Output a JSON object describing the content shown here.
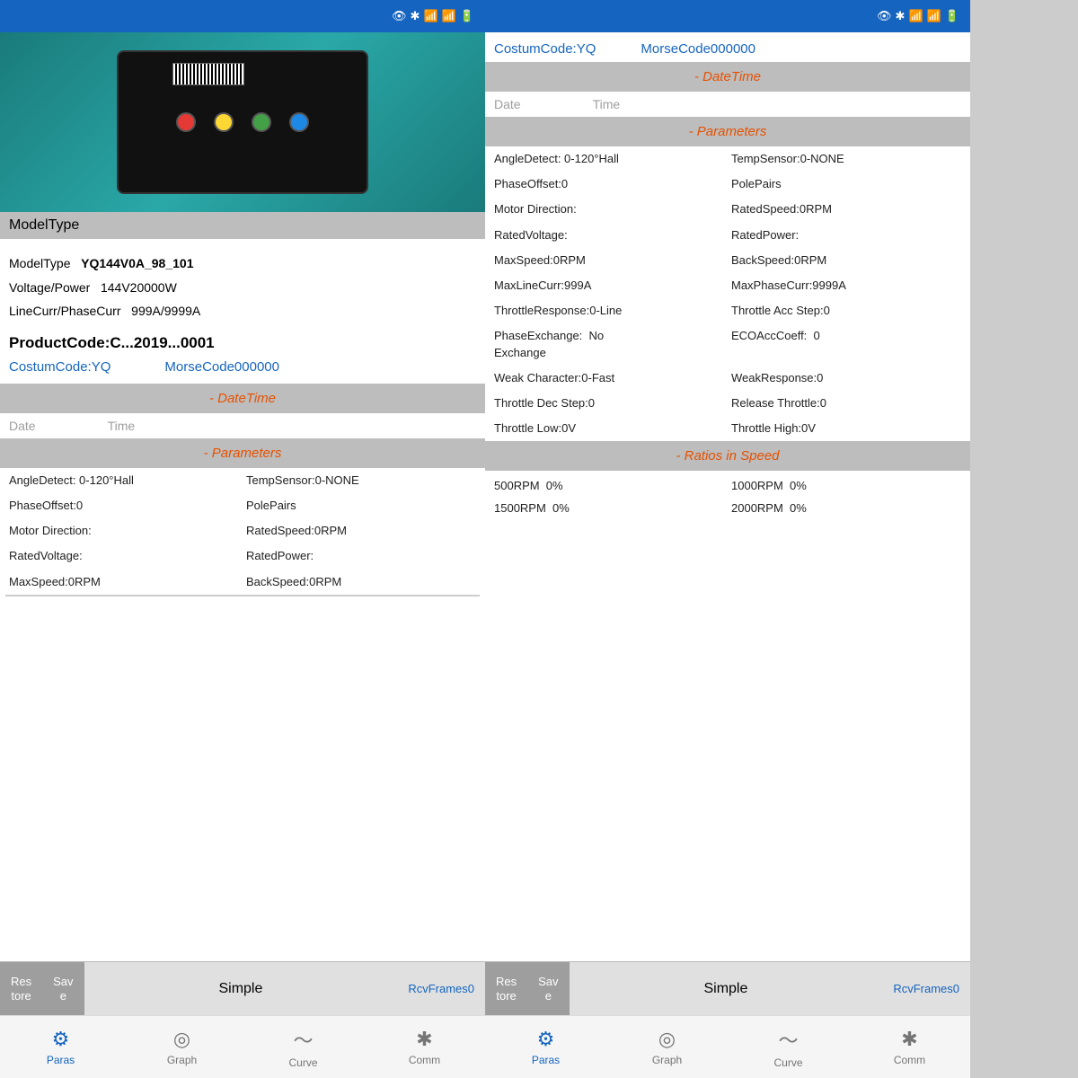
{
  "panel_left": {
    "status_bar": {
      "icons": "👁 ✱ 📶 📶 🔋"
    },
    "model_type_header": "ModelType",
    "model_info": {
      "model_type_label": "ModelType",
      "model_type_value": "YQ144V0A_98_101",
      "voltage_label": "Voltage/Power",
      "voltage_value": "144V20000W",
      "line_curr_label": "LineCurr/PhaseCurr",
      "line_curr_value": "999A/9999A"
    },
    "product_code": "ProductCode:C...2019...0001",
    "costum_code": "CostumCode:YQ",
    "morse_code": "MorseCode000000",
    "datetime_header": "- DateTime",
    "date_label": "Date",
    "time_label": "Time",
    "parameters_header": "- Parameters",
    "params": [
      {
        "left": "AngleDetect: 0-120°Hall",
        "right": "TempSensor:0-NONE"
      },
      {
        "left": "PhaseOffset:0",
        "right": "PolePairs"
      },
      {
        "left": "Motor Direction:",
        "right": "RatedSpeed:0RPM"
      },
      {
        "left": "RatedVoltage:",
        "right": "RatedPower:"
      },
      {
        "left": "MaxSpeed:0RPM (partial)",
        "right": "BackSpeed:0RPM (partial)"
      }
    ],
    "toolbar": {
      "restore": "Res\ntore",
      "save": "Sav\ne",
      "simple": "Simple",
      "rcv_frames": "RcvFrames0"
    },
    "nav": {
      "paras": "Paras",
      "graph": "Graph",
      "curve": "Curve",
      "comm": "Comm"
    }
  },
  "panel_right": {
    "status_bar": {
      "icons": "👁 ✱ 📶 📶 🔋"
    },
    "costum_code": "CostumCode:YQ",
    "morse_code": "MorseCode000000",
    "datetime_header": "- DateTime",
    "date_label": "Date",
    "time_label": "Time",
    "parameters_header": "- Parameters",
    "params": [
      {
        "left": "AngleDetect: 0-120°Hall",
        "right": "TempSensor:0-NONE"
      },
      {
        "left": "PhaseOffset:0",
        "right": "PolePairs"
      },
      {
        "left": "Motor Direction:",
        "right": "RatedSpeed:0RPM"
      },
      {
        "left": "RatedVoltage:",
        "right": "RatedPower:"
      },
      {
        "left": "MaxSpeed:0RPM",
        "right": "BackSpeed:0RPM"
      },
      {
        "left": "MaxLineCurr:999A",
        "right": "MaxPhaseCurr:9999A"
      },
      {
        "left": "ThrottleResponse:0-Line",
        "right": "Throttle Acc Step:0"
      },
      {
        "left": "PhaseExchange:  No\nExchange",
        "right": "ECOAccCoeff:  0"
      },
      {
        "left": "Weak Character:0-Fast",
        "right": "WeakResponse:0"
      },
      {
        "left": "Throttle Dec Step:0",
        "right": "Release Throttle:0"
      },
      {
        "left": "Throttle Low:0V",
        "right": "Throttle High:0V"
      }
    ],
    "ratios_header": "- Ratios in Speed",
    "ratios": [
      {
        "left": "500RPM  0%",
        "right": "1000RPM  0%"
      },
      {
        "left": "1500RPM  0%",
        "right": "2000RPM  0%"
      }
    ],
    "toolbar": {
      "restore": "Res\ntore",
      "save": "Sav\ne",
      "simple": "Simple",
      "rcv_frames": "RcvFrames0"
    },
    "nav": {
      "paras": "Paras",
      "graph": "Graph",
      "curve": "Curve",
      "comm": "Comm"
    }
  }
}
